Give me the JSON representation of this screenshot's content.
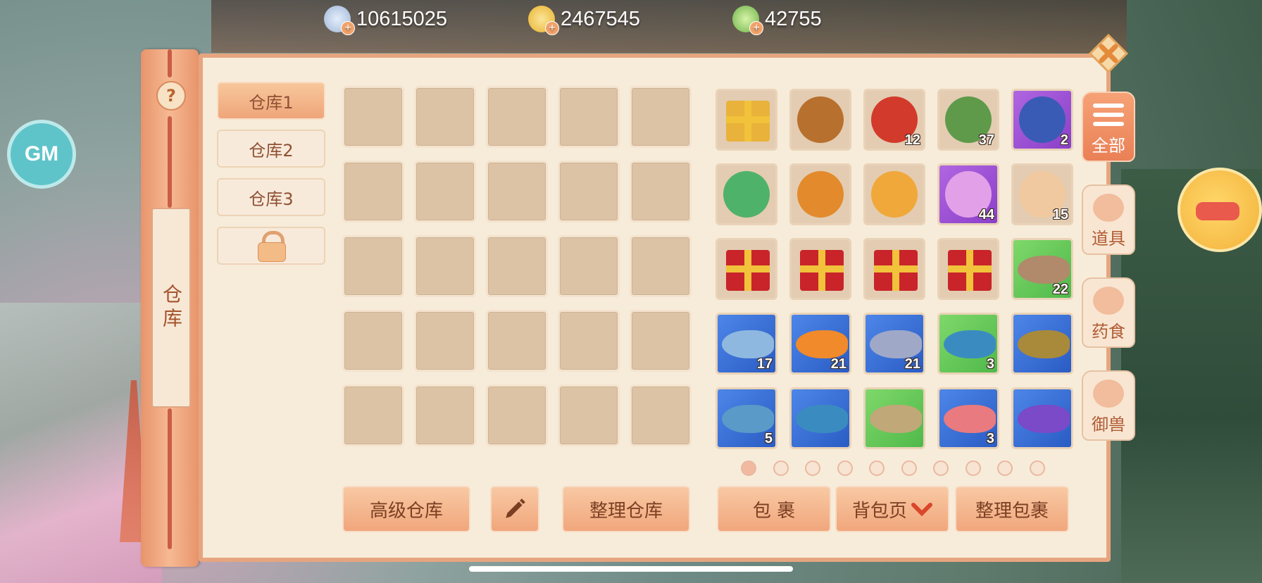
{
  "currencies": [
    {
      "icon": "silver-coin-icon",
      "value": "10615025",
      "color": "#9fb7d8"
    },
    {
      "icon": "gold-coin-icon",
      "value": "2467545",
      "color": "#f0c54a"
    },
    {
      "icon": "jade-coin-icon",
      "value": "42755",
      "color": "#8bc86a"
    }
  ],
  "side": {
    "help": "?",
    "label": "仓库"
  },
  "warehouse_tabs": [
    "仓库1",
    "仓库2",
    "仓库3"
  ],
  "warehouse_active": "仓库1",
  "buttons": {
    "advanced": "高级仓库",
    "organize_warehouse": "整理仓库",
    "bag": "包 裹",
    "bag_page": "背包页",
    "organize_bag": "整理包裹"
  },
  "categories": [
    {
      "name": "全部",
      "icon": "menu-list-icon",
      "active": true
    },
    {
      "name": "道具",
      "icon": "pouch-icon",
      "active": false
    },
    {
      "name": "药食",
      "icon": "peach-icon",
      "active": false
    },
    {
      "name": "御兽",
      "icon": "horse-head-icon",
      "active": false
    }
  ],
  "gm_label": "GM",
  "bag_items": [
    {
      "icon": "gift-box-icon",
      "quality": "plain",
      "count": ""
    },
    {
      "icon": "book-icon",
      "quality": "plain",
      "count": ""
    },
    {
      "icon": "red-lucky-bag-icon",
      "quality": "plain",
      "count": "12"
    },
    {
      "icon": "green-scroll-icon",
      "quality": "plain",
      "count": "37"
    },
    {
      "icon": "blue-scroll-icon",
      "quality": "purple",
      "count": "2"
    },
    {
      "icon": "green-card-icon",
      "quality": "plain",
      "count": ""
    },
    {
      "icon": "treasure-chest-icon",
      "quality": "plain",
      "count": ""
    },
    {
      "icon": "gold-chest-icon",
      "quality": "plain",
      "count": ""
    },
    {
      "icon": "crystal-chest-icon",
      "quality": "purple",
      "count": "44"
    },
    {
      "icon": "cookie-plate-icon",
      "quality": "plain",
      "count": "15"
    },
    {
      "icon": "gold-gift-box-icon",
      "quality": "plain",
      "count": ""
    },
    {
      "icon": "gold-gift-box-icon",
      "quality": "plain",
      "count": ""
    },
    {
      "icon": "gold-gift-box-icon",
      "quality": "plain",
      "count": ""
    },
    {
      "icon": "gold-gift-box-icon",
      "quality": "plain",
      "count": ""
    },
    {
      "icon": "brown-fish-icon",
      "quality": "green",
      "count": "22"
    },
    {
      "icon": "axolotl-icon",
      "quality": "blue",
      "count": "17"
    },
    {
      "icon": "goldfish-icon",
      "quality": "blue",
      "count": "21"
    },
    {
      "icon": "silver-fish-icon",
      "quality": "blue",
      "count": "21"
    },
    {
      "icon": "blue-fish-icon",
      "quality": "green",
      "count": "3"
    },
    {
      "icon": "carp-icon",
      "quality": "blue",
      "count": ""
    },
    {
      "icon": "tuna-icon",
      "quality": "blue",
      "count": "5"
    },
    {
      "icon": "blue-fish-icon",
      "quality": "blue",
      "count": ""
    },
    {
      "icon": "green-fish-icon",
      "quality": "green",
      "count": ""
    },
    {
      "icon": "koi-icon",
      "quality": "blue",
      "count": "3"
    },
    {
      "icon": "betta-fish-icon",
      "quality": "blue",
      "count": ""
    }
  ],
  "page_dots": {
    "total": 10,
    "active": 0
  },
  "colors": {
    "panel_border": "#e6a57f",
    "button": "#f1a67c",
    "text_brown": "#7a3f22"
  }
}
